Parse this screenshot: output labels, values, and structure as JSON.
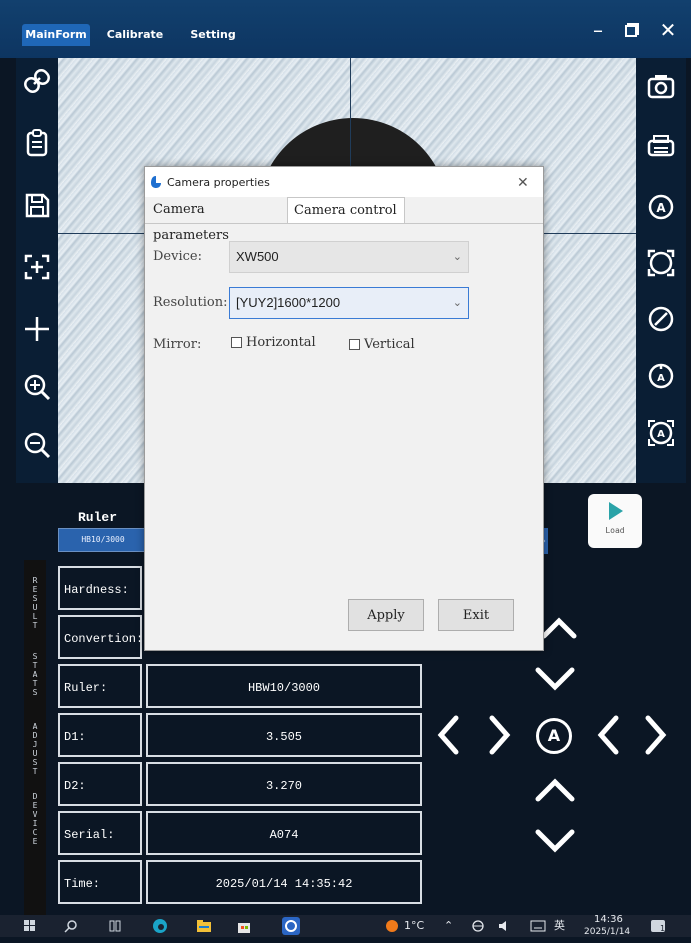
{
  "titlebar": {
    "tabs": [
      "MainForm",
      "Calibrate",
      "Setting"
    ],
    "active_tab": "MainForm"
  },
  "left_tools": [
    "link-icon",
    "clipboard-icon",
    "save-icon",
    "focus-plus-icon",
    "add-icon",
    "zoom-in-icon",
    "zoom-out-icon"
  ],
  "right_tools": [
    "camera-icon",
    "printer-icon",
    "auto-measure-icon",
    "frame-measure-icon",
    "diagonal-measure-icon",
    "auto-diagonal-icon",
    "auto-frame-icon"
  ],
  "ruler": {
    "label": "Ruler",
    "selected": "HB10/3000"
  },
  "side_tabs": [
    "RESULT",
    "STATS",
    "ADJUST",
    "DEVICE"
  ],
  "results": [
    {
      "label": "Hardness:",
      "value": ""
    },
    {
      "label": "Convertion:",
      "value": ""
    },
    {
      "label": "Ruler:",
      "value": "HBW10/3000"
    },
    {
      "label": "D1:",
      "value": "3.505"
    },
    {
      "label": "D2:",
      "value": "3.270"
    },
    {
      "label": "Serial:",
      "value": "A074"
    },
    {
      "label": "Time:",
      "value": "2025/01/14 14:35:42"
    }
  ],
  "load_button": "Load",
  "center_button": "A",
  "dialog": {
    "title": "Camera properties",
    "tabs": [
      "Camera parameters",
      "Camera control"
    ],
    "active_tab": "Camera control",
    "device_label": "Device:",
    "device_value": "XW500",
    "resolution_label": "Resolution:",
    "resolution_value": "[YUY2]1600*1200",
    "mirror_label": "Mirror:",
    "mirror_horizontal": "Horizontal",
    "mirror_vertical": "Vertical",
    "apply_label": "Apply",
    "exit_label": "Exit"
  },
  "taskbar": {
    "temperature": "1°C",
    "ime": "英",
    "time": "14:36",
    "date": "2025/1/14"
  },
  "colors": {
    "titlebar": "#12406e",
    "active_tab": "#1f67b7",
    "panel": "#0b1624",
    "ruler_select": "#2a63ad"
  }
}
